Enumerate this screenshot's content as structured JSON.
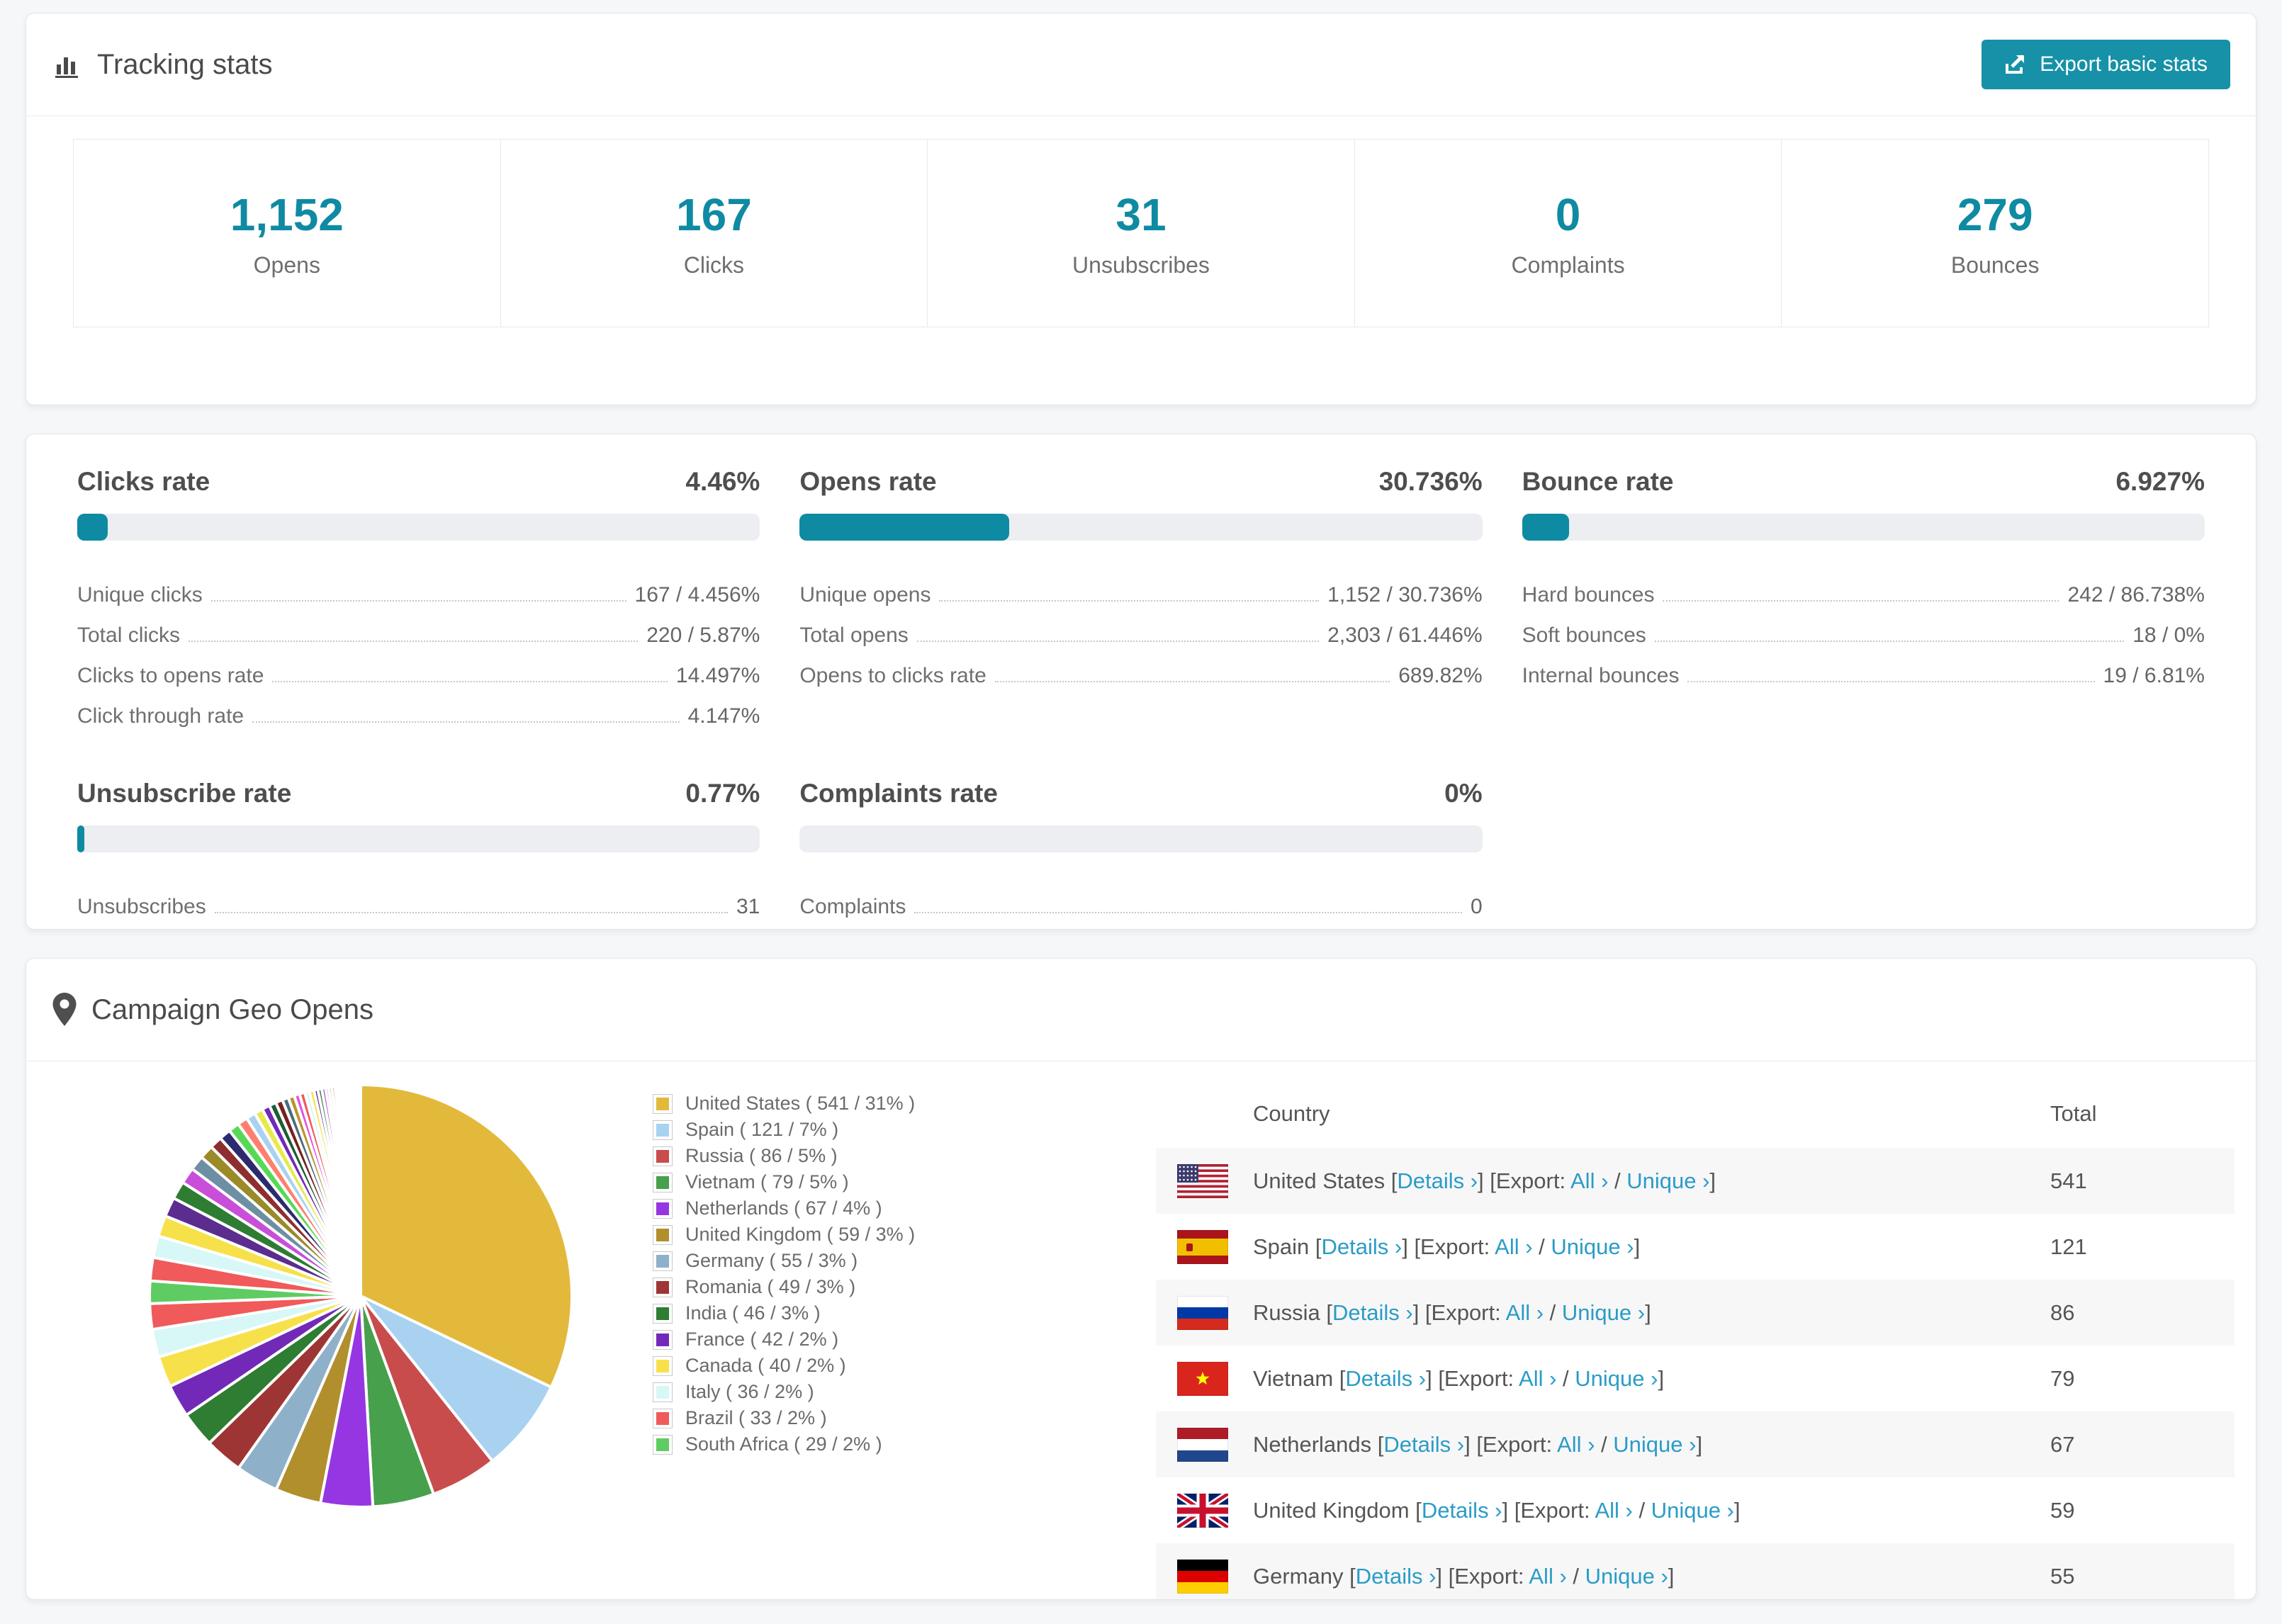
{
  "colors": {
    "accent_teal": "#0f8aa3",
    "button_teal": "#1691a7",
    "link_blue": "#2a9cc6",
    "text_dark": "#4a4a4a",
    "text_gray": "#6f6f6f",
    "bar_track": "#eceef1",
    "row_stripe": "#f7f7f8"
  },
  "tracking": {
    "title": "Tracking stats",
    "icon": "bar-chart-icon",
    "export_button": {
      "label": "Export basic stats",
      "icon": "export-icon"
    },
    "summary": [
      {
        "value": "1,152",
        "label": "Opens"
      },
      {
        "value": "167",
        "label": "Clicks"
      },
      {
        "value": "31",
        "label": "Unsubscribes"
      },
      {
        "value": "0",
        "label": "Complaints"
      },
      {
        "value": "279",
        "label": "Bounces"
      }
    ]
  },
  "rates": {
    "row1": [
      {
        "id": "clicks-rate",
        "title": "Clicks rate",
        "value": "4.46%",
        "percent": 4.46,
        "rows": [
          {
            "label": "Unique clicks",
            "value": "167 / 4.456%"
          },
          {
            "label": "Total clicks",
            "value": "220 / 5.87%"
          },
          {
            "label": "Clicks to opens rate",
            "value": "14.497%"
          },
          {
            "label": "Click through rate",
            "value": "4.147%"
          }
        ]
      },
      {
        "id": "opens-rate",
        "title": "Opens rate",
        "value": "30.736%",
        "percent": 30.736,
        "rows": [
          {
            "label": "Unique opens",
            "value": "1,152 / 30.736%"
          },
          {
            "label": "Total opens",
            "value": "2,303 / 61.446%"
          },
          {
            "label": "Opens to clicks rate",
            "value": "689.82%"
          }
        ]
      },
      {
        "id": "bounce-rate",
        "title": "Bounce rate",
        "value": "6.927%",
        "percent": 6.927,
        "rows": [
          {
            "label": "Hard bounces",
            "value": "242 / 86.738%"
          },
          {
            "label": "Soft bounces",
            "value": "18 / 0%"
          },
          {
            "label": "Internal bounces",
            "value": "19 / 6.81%"
          }
        ]
      }
    ],
    "row2": [
      {
        "id": "unsubscribe-rate",
        "title": "Unsubscribe rate",
        "value": "0.77%",
        "percent": 0.77,
        "rows": [
          {
            "label": "Unsubscribes",
            "value": "31"
          }
        ]
      },
      {
        "id": "complaints-rate",
        "title": "Complaints rate",
        "value": "0%",
        "percent": 0,
        "rows": [
          {
            "label": "Complaints",
            "value": "0"
          }
        ]
      }
    ]
  },
  "geo": {
    "title": "Campaign Geo Opens",
    "icon": "map-pin-icon",
    "chart_data": {
      "type": "pie",
      "title": "Campaign Geo Opens",
      "legend_position": "right-list",
      "start_angle_deg": -90,
      "direction": "clockwise",
      "labels": [
        "United States",
        "Spain",
        "Russia",
        "Vietnam",
        "Netherlands",
        "United Kingdom",
        "Germany",
        "Romania",
        "India",
        "France",
        "Canada",
        "Italy",
        "Brazil",
        "South Africa"
      ],
      "values": [
        541,
        121,
        86,
        79,
        67,
        59,
        55,
        49,
        46,
        42,
        40,
        36,
        33,
        29
      ],
      "percents": [
        "31%",
        "7%",
        "5%",
        "5%",
        "4%",
        "3%",
        "3%",
        "3%",
        "3%",
        "2%",
        "2%",
        "2%",
        "2%",
        "2%"
      ],
      "colors": [
        "#e2b93b",
        "#a8d2f0",
        "#c84c4c",
        "#47a04b",
        "#9636e3",
        "#b18f2c",
        "#8fb0c9",
        "#9e3535",
        "#2e7d32",
        "#7229b8",
        "#f7e14b",
        "#d8f7f7",
        "#f05a5a",
        "#5ecc62"
      ],
      "unlabeled_tail": {
        "note": "remaining small countries shown as thin unlabeled slices",
        "values": [
          30,
          28,
          27,
          25,
          23,
          21,
          19,
          18,
          16,
          15,
          14,
          13,
          12,
          11,
          10,
          9,
          9,
          8,
          8,
          7,
          7,
          6,
          6,
          5,
          5,
          5,
          4,
          4,
          4,
          3,
          3,
          3,
          3,
          2,
          2,
          2,
          2,
          2,
          2,
          1,
          1,
          1,
          1,
          1,
          1,
          1,
          1,
          1
        ],
        "palette": [
          "#f05a5a",
          "#d8f7f7",
          "#f7e14b",
          "#5b2d8e",
          "#2e7d32",
          "#c94fd8",
          "#6e8ea3",
          "#9a8a28",
          "#8e2f2f",
          "#2b2b6e",
          "#57d957",
          "#ff7f6e",
          "#a8d2f0",
          "#e8e84a",
          "#7229b8",
          "#1e5c33",
          "#7a1f1f",
          "#4a6b7e",
          "#b8962e",
          "#e152e1"
        ]
      }
    },
    "legend_format": "{name} ( {value} / {percent} )",
    "table": {
      "headers": {
        "country": "Country",
        "total": "Total"
      },
      "link_text": {
        "details": "Details ›",
        "export_label": "Export:",
        "all": "All ›",
        "unique": "Unique ›"
      },
      "rows": [
        {
          "country": "United States",
          "flag": "us",
          "total": "541"
        },
        {
          "country": "Spain",
          "flag": "es",
          "total": "121"
        },
        {
          "country": "Russia",
          "flag": "ru",
          "total": "86"
        },
        {
          "country": "Vietnam",
          "flag": "vn",
          "total": "79"
        },
        {
          "country": "Netherlands",
          "flag": "nl",
          "total": "67"
        },
        {
          "country": "United Kingdom",
          "flag": "gb",
          "total": "59"
        },
        {
          "country": "Germany",
          "flag": "de",
          "total": "55"
        }
      ]
    }
  }
}
